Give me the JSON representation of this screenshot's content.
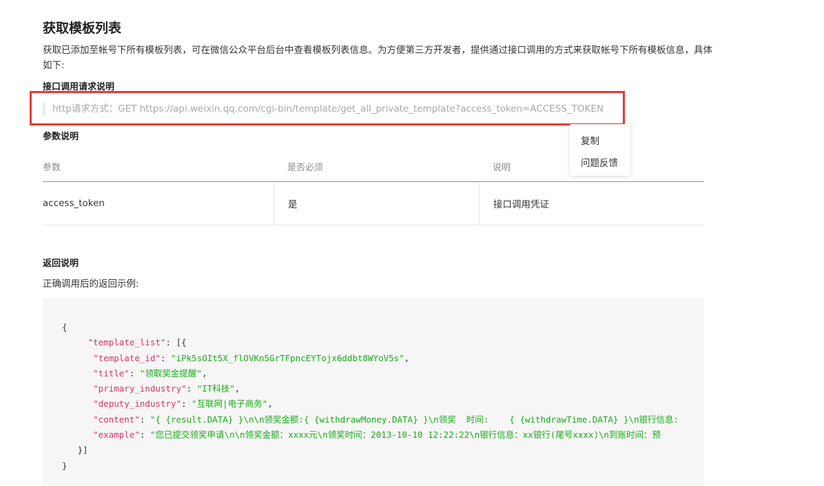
{
  "page": {
    "title": "获取模板列表",
    "description": "获取已添加至帐号下所有模板列表，可在微信公众平台后台中查看模板列表信息。为方便第三方开发者，提供通过接口调用的方式来获取帐号下所有模板信息，具体如下:"
  },
  "request": {
    "heading": "接口调用请求说明",
    "http_line": "http请求方式：GET https://api.weixin.qq.com/cgi-bin/template/get_all_private_template?access_token=ACCESS_TOKEN"
  },
  "params": {
    "heading": "参数说明",
    "columns": [
      "参数",
      "是否必须",
      "说明"
    ],
    "rows": [
      [
        "access_token",
        "是",
        "接口调用凭证"
      ]
    ]
  },
  "response": {
    "heading": "返回说明",
    "description": "正确调用后的返回示例:",
    "code": {
      "open_brace": "{",
      "list_key": "\"template_list\"",
      "list_open": ": [{",
      "fields": [
        {
          "key": "\"template_id\"",
          "value": "\"iPk5sOIt5X_flOVKn5GrTFpncEYTojx6ddbt8WYoV5s\"",
          "trail": ","
        },
        {
          "key": "\"title\"",
          "value": "\"领取奖金提醒\"",
          "trail": ","
        },
        {
          "key": "\"primary_industry\"",
          "value": "\"IT科技\"",
          "trail": ","
        },
        {
          "key": "\"deputy_industry\"",
          "value": "\"互联网|电子商务\"",
          "trail": ","
        },
        {
          "key": "\"content\"",
          "value": "\"{ {result.DATA} }\\n\\n领奖金额:{ {withdrawMoney.DATA} }\\n领奖  时间:    { {withdrawTime.DATA} }\\n银行信息:",
          "trail": ""
        },
        {
          "key": "\"example\"",
          "value": "\"您已提交领奖申请\\n\\n领奖金额：xxxx元\\n领奖时间：2013-10-10 12:22:22\\n银行信息：xx银行(尾号xxxx)\\n到账时间：预",
          "trail": ""
        }
      ],
      "list_close": "}]",
      "close_brace": "}"
    }
  },
  "context_menu": {
    "items": [
      "复制",
      "问题反馈"
    ]
  }
}
